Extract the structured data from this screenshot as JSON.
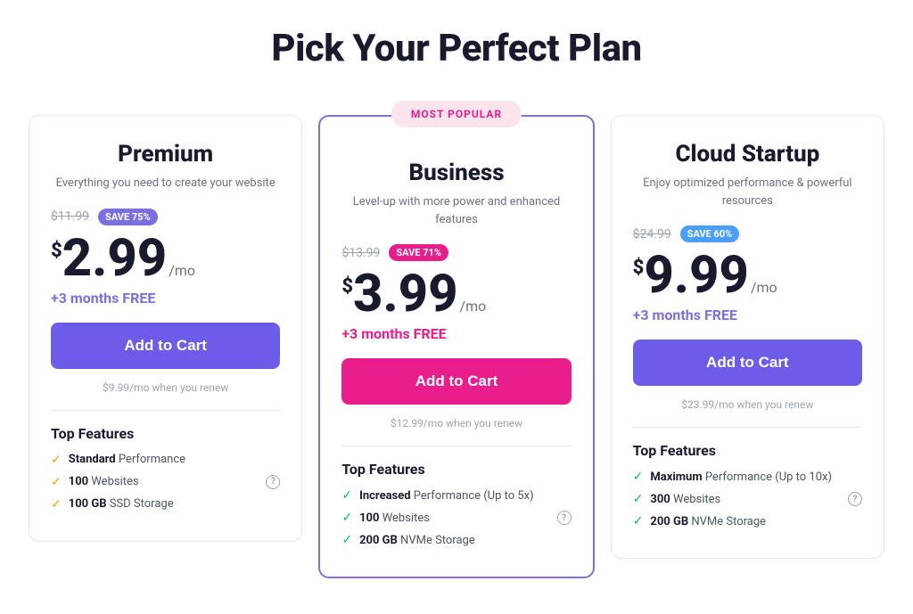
{
  "page": {
    "title": "Pick Your Perfect Plan"
  },
  "plans": [
    {
      "id": "premium",
      "name": "Premium",
      "desc": "Everything you need to create your website",
      "original_price": "$11.99",
      "save_label": "SAVE 75%",
      "save_color": "purple",
      "price_dollar": "$",
      "price_amount": "2.99",
      "price_period": "/mo",
      "free_months": "+3 months FREE",
      "free_months_color": "purple",
      "btn_label": "Add to Cart",
      "btn_color": "purple",
      "renew_text": "$9.99/mo when you renew",
      "featured": false,
      "most_popular": "",
      "features_title": "Top Features",
      "features": [
        {
          "bold": "Standard",
          "text": " Performance",
          "check_color": "yellow",
          "has_help": false
        },
        {
          "bold": "100",
          "text": " Websites",
          "check_color": "yellow",
          "has_help": true
        },
        {
          "bold": "100 GB",
          "text": " SSD Storage",
          "check_color": "yellow",
          "has_help": false
        }
      ]
    },
    {
      "id": "business",
      "name": "Business",
      "desc": "Level-up with more power and enhanced features",
      "original_price": "$13.99",
      "save_label": "SAVE 71%",
      "save_color": "pink",
      "price_dollar": "$",
      "price_amount": "3.99",
      "price_period": "/mo",
      "free_months": "+3 months FREE",
      "free_months_color": "pink",
      "btn_label": "Add to Cart",
      "btn_color": "pink",
      "renew_text": "$12.99/mo when you renew",
      "featured": true,
      "most_popular": "MOST POPULAR",
      "features_title": "Top Features",
      "features": [
        {
          "bold": "Increased",
          "text": " Performance (Up to 5x)",
          "check_color": "green",
          "has_help": false
        },
        {
          "bold": "100",
          "text": " Websites",
          "check_color": "green",
          "has_help": true
        },
        {
          "bold": "200 GB",
          "text": " NVMe Storage",
          "check_color": "green",
          "has_help": false
        }
      ]
    },
    {
      "id": "cloud-startup",
      "name": "Cloud Startup",
      "desc": "Enjoy optimized performance & powerful resources",
      "original_price": "$24.99",
      "save_label": "SAVE 60%",
      "save_color": "blue",
      "price_dollar": "$",
      "price_amount": "9.99",
      "price_period": "/mo",
      "free_months": "+3 months FREE",
      "free_months_color": "purple",
      "btn_label": "Add to Cart",
      "btn_color": "purple",
      "renew_text": "$23.99/mo when you renew",
      "featured": false,
      "most_popular": "",
      "features_title": "Top Features",
      "features": [
        {
          "bold": "Maximum",
          "text": " Performance (Up to 10x)",
          "check_color": "green",
          "has_help": false
        },
        {
          "bold": "300",
          "text": " Websites",
          "check_color": "green",
          "has_help": true
        },
        {
          "bold": "200 GB",
          "text": " NVMe Storage",
          "check_color": "green",
          "has_help": false
        }
      ]
    }
  ]
}
